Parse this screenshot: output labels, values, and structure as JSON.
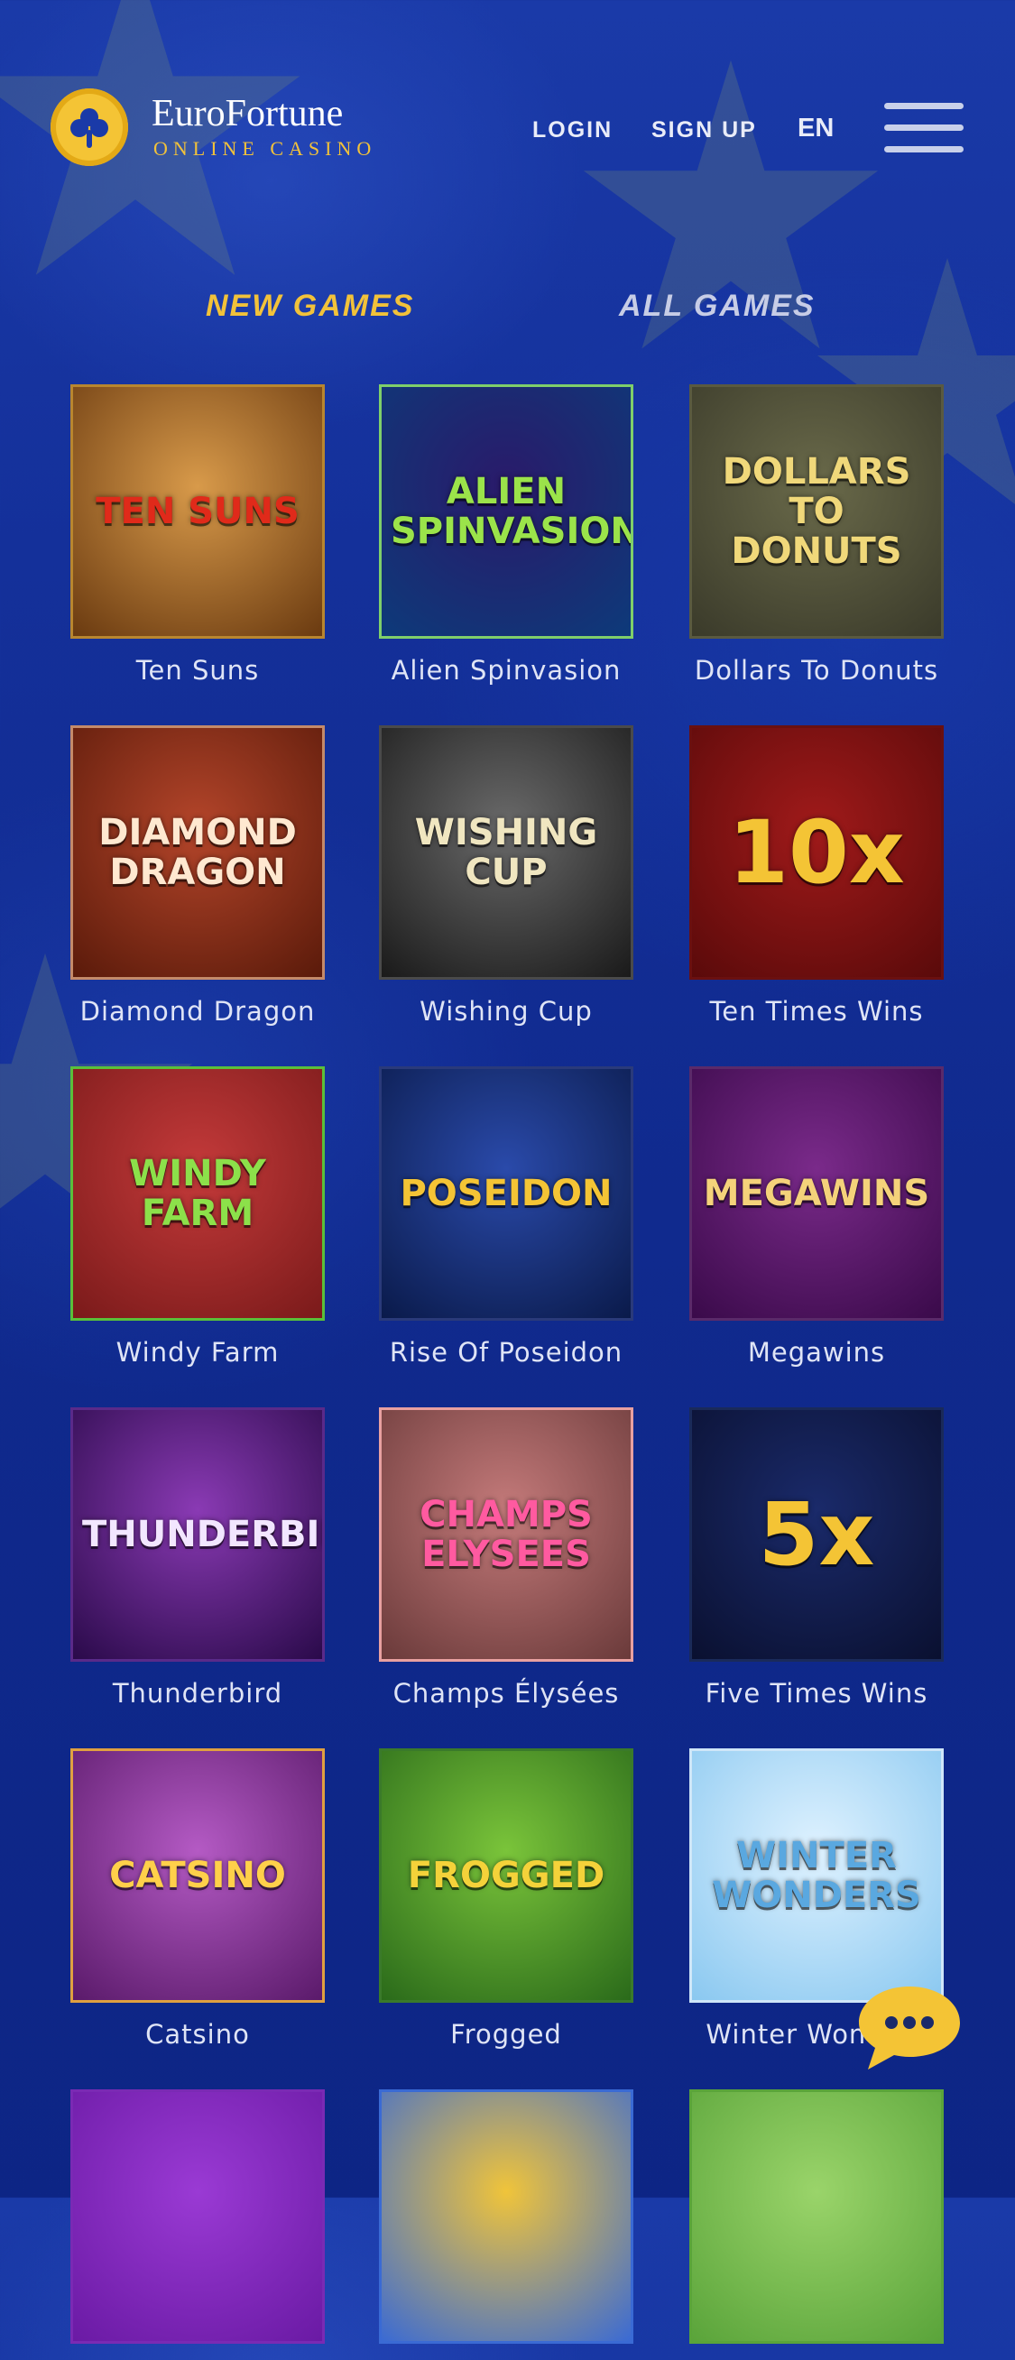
{
  "brand": {
    "title": "EuroFortune",
    "subtitle": "ONLINE CASINO"
  },
  "nav": {
    "login": "LOGIN",
    "signup": "SIGN UP",
    "language": "EN"
  },
  "tabs": [
    {
      "label": "NEW GAMES",
      "active": true
    },
    {
      "label": "ALL GAMES",
      "active": false
    }
  ],
  "colors": {
    "accent": "#f2c23a",
    "inactive_tab": "#c7cde6",
    "background": "#14309a"
  },
  "games": [
    {
      "name": "Ten Suns",
      "art_text": "TEN SUNS",
      "bg1": "#d89a4a",
      "bg2": "#6a3a10",
      "text_color": "#e02a1a",
      "border": "#b8862f"
    },
    {
      "name": "Alien Spinvasion",
      "art_text": "ALIEN SPINVASION!",
      "bg1": "#2a1a6a",
      "bg2": "#0d3a7a",
      "text_color": "#9be34a",
      "border": "#7fcf6a"
    },
    {
      "name": "Dollars To Donuts",
      "art_text": "DOLLARS TO DONUTS",
      "bg1": "#6a6a4a",
      "bg2": "#3a3a2a",
      "text_color": "#f0d87a",
      "border": "#5a5a40"
    },
    {
      "name": "Diamond Dragon",
      "art_text": "DIAMOND DRAGON",
      "bg1": "#b4452a",
      "bg2": "#5a1a0a",
      "text_color": "#ffe8d0",
      "border": "#c48a6a"
    },
    {
      "name": "Wishing Cup",
      "art_text": "WISHING CUP",
      "bg1": "#6a6a6a",
      "bg2": "#1a1a1a",
      "text_color": "#f0e6c0",
      "border": "#4a4a4a"
    },
    {
      "name": "Ten Times Wins",
      "art_text": "10x",
      "bg1": "#a01a1a",
      "bg2": "#5a0a0a",
      "text_color": "#f4c435",
      "border": "#6a1010"
    },
    {
      "name": "Windy Farm",
      "art_text": "WINDY FARM",
      "bg1": "#c43a3a",
      "bg2": "#7a1a1a",
      "text_color": "#8ce04a",
      "border": "#5ac03a"
    },
    {
      "name": "Rise Of Poseidon",
      "art_text": "POSEIDON",
      "bg1": "#2a4aaa",
      "bg2": "#0a1a4a",
      "text_color": "#f4c435",
      "border": "#2a3a7a"
    },
    {
      "name": "Megawins",
      "art_text": "MEGAWINS",
      "bg1": "#7a2a8a",
      "bg2": "#3a0a4a",
      "text_color": "#f4d27a",
      "border": "#5a2a6a"
    },
    {
      "name": "Thunderbird",
      "art_text": "THUNDERBIRD",
      "bg1": "#8a3ab4",
      "bg2": "#2a0a4a",
      "text_color": "#f2e6ff",
      "border": "#5a2a8a"
    },
    {
      "name": "Champs Élysées",
      "art_text": "CHAMPS ELYSEES",
      "bg1": "#c47a7a",
      "bg2": "#6a3a3a",
      "text_color": "#ff5aa0",
      "border": "#e8a0a0"
    },
    {
      "name": "Five Times Wins",
      "art_text": "5x",
      "bg1": "#1a2a6a",
      "bg2": "#0a1030",
      "text_color": "#f4c435",
      "border": "#1a2a5a"
    },
    {
      "name": "Catsino",
      "art_text": "CATSINO",
      "bg1": "#b45ac4",
      "bg2": "#5a1a6a",
      "text_color": "#ffd04a",
      "border": "#e0a040"
    },
    {
      "name": "Frogged",
      "art_text": "FROGGED",
      "bg1": "#7ac43a",
      "bg2": "#2a6a1a",
      "text_color": "#f4d23a",
      "border": "#3a7a2a"
    },
    {
      "name": "Winter Wonders",
      "art_text": "WINTER WONDERS",
      "bg1": "#dff2ff",
      "bg2": "#8ac8f0",
      "text_color": "#5aa8e0",
      "border": "#cfe6f8"
    },
    {
      "name": "",
      "art_text": "",
      "bg1": "#9a3ad4",
      "bg2": "#6a1aa4",
      "text_color": "#ffffff",
      "border": "#7a2ab4"
    },
    {
      "name": "",
      "art_text": "",
      "bg1": "#f0c43a",
      "bg2": "#3a6ad4",
      "text_color": "#ffffff",
      "border": "#3a6ad4"
    },
    {
      "name": "",
      "art_text": "",
      "bg1": "#9ad46a",
      "bg2": "#5aa43a",
      "text_color": "#ffffff",
      "border": "#5aa43a"
    }
  ],
  "chat": {
    "icon": "chat-bubble-icon"
  }
}
